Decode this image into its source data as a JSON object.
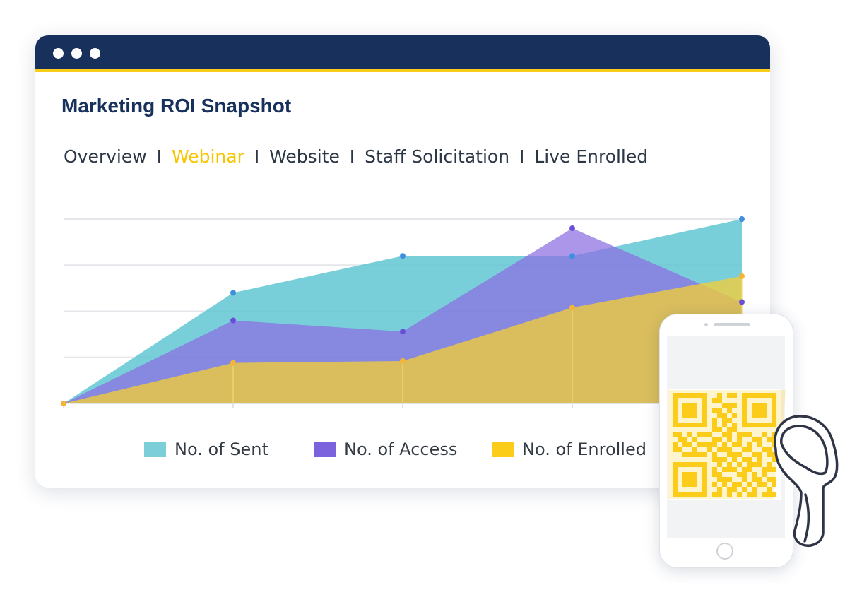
{
  "window": {
    "title": "Marketing ROI Snapshot",
    "tabs": [
      {
        "label": "Overview",
        "active": false
      },
      {
        "label": "Webinar",
        "active": true
      },
      {
        "label": "Website",
        "active": false
      },
      {
        "label": "Staff Solicitation",
        "active": false
      },
      {
        "label": "Live Enrolled",
        "active": false
      }
    ],
    "tab_separator": "I"
  },
  "colors": {
    "titlebar": "#17315c",
    "titlebar_accent": "#fbcc1a",
    "active_tab": "#f7c600",
    "sent": "#5cc5d1",
    "access": "#8a6ee0",
    "enrolled": "#f2cd3a",
    "qr": "#fbcc1a",
    "scanner_outline": "#2f3546"
  },
  "chart_data": {
    "type": "area",
    "x": [
      0,
      1,
      2,
      3,
      4
    ],
    "ylim": [
      0,
      100
    ],
    "grid": true,
    "legend_position": "bottom",
    "series": [
      {
        "name": "No. of Sent",
        "values": [
          0,
          60,
          80,
          80,
          100
        ],
        "color": "#5cc5d1"
      },
      {
        "name": "No. of Access",
        "values": [
          0,
          45,
          39,
          95,
          55
        ],
        "color": "#8a6ee0"
      },
      {
        "name": "No. of Enrolled",
        "values": [
          0,
          22,
          23,
          52,
          69
        ],
        "color": "#f2cd3a"
      }
    ]
  },
  "phone": {
    "qr_icon": "qr-code-icon",
    "scanner_icon": "barcode-scanner-icon"
  }
}
